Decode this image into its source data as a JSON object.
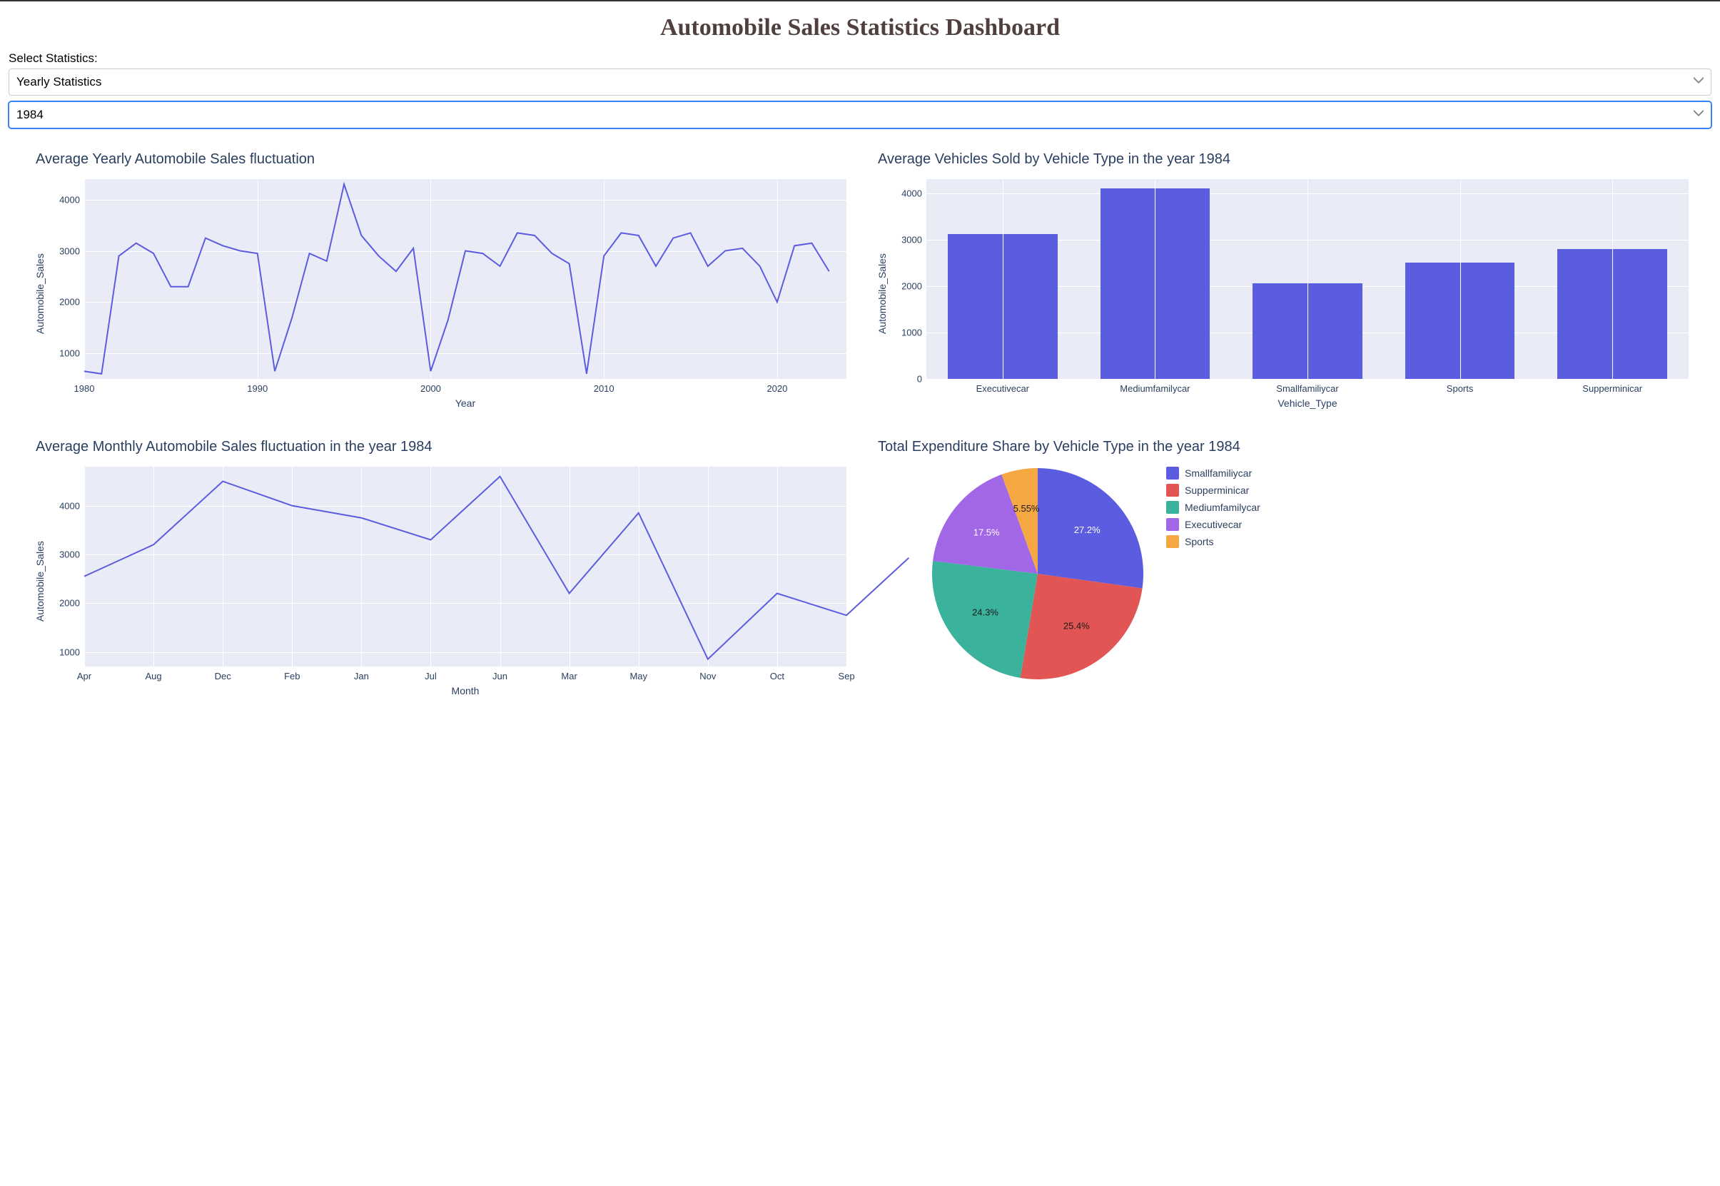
{
  "page": {
    "title": "Automobile Sales Statistics Dashboard",
    "select_label": "Select Statistics:",
    "statistic_value": "Yearly Statistics",
    "year_value": "1984"
  },
  "chart_data": [
    {
      "id": "yearly_line",
      "type": "line",
      "title": "Average Yearly Automobile Sales fluctuation",
      "xlabel": "Year",
      "ylabel": "Automobile_Sales",
      "xlim": [
        1980,
        2024
      ],
      "ylim": [
        500,
        4400
      ],
      "yticks": [
        1000,
        2000,
        3000,
        4000
      ],
      "xticks": [
        1980,
        1990,
        2000,
        2010,
        2020
      ],
      "x": [
        1980,
        1981,
        1982,
        1983,
        1984,
        1985,
        1986,
        1987,
        1988,
        1989,
        1990,
        1991,
        1992,
        1993,
        1994,
        1995,
        1996,
        1997,
        1998,
        1999,
        2000,
        2001,
        2002,
        2003,
        2004,
        2005,
        2006,
        2007,
        2008,
        2009,
        2010,
        2011,
        2012,
        2013,
        2014,
        2015,
        2016,
        2017,
        2018,
        2019,
        2020,
        2021,
        2022,
        2023
      ],
      "values": [
        650,
        600,
        2900,
        3150,
        2950,
        2300,
        2300,
        3250,
        3100,
        3000,
        2950,
        650,
        1700,
        2950,
        2800,
        4300,
        3300,
        2900,
        2600,
        3050,
        650,
        1650,
        3000,
        2950,
        2700,
        3350,
        3300,
        2950,
        2750,
        600,
        2900,
        3350,
        3300,
        2700,
        3250,
        3350,
        2700,
        3000,
        3050,
        2700,
        2000,
        3100,
        3150,
        2600
      ],
      "color": "#5c5ce0"
    },
    {
      "id": "vehicle_bar",
      "type": "bar",
      "title": "Average Vehicles Sold by Vehicle Type in the year 1984",
      "xlabel": "Vehicle_Type",
      "ylabel": "Automobile_Sales",
      "ylim": [
        0,
        4300
      ],
      "yticks": [
        0,
        1000,
        2000,
        3000,
        4000
      ],
      "categories": [
        "Executivecar",
        "Mediumfamilycar",
        "Smallfamiliycar",
        "Sports",
        "Supperminicar"
      ],
      "values": [
        3120,
        4100,
        2060,
        2510,
        2790
      ],
      "color": "#5c5ce0"
    },
    {
      "id": "monthly_line",
      "type": "line",
      "title": "Average Monthly Automobile Sales fluctuation in the year 1984",
      "xlabel": "Month",
      "ylabel": "Automobile_Sales",
      "ylim": [
        700,
        4800
      ],
      "yticks": [
        1000,
        2000,
        3000,
        4000
      ],
      "categories": [
        "Apr",
        "Aug",
        "Dec",
        "Feb",
        "Jan",
        "Jul",
        "Jun",
        "Mar",
        "May",
        "Nov",
        "Oct",
        "Sep"
      ],
      "values": [
        2550,
        3200,
        4500,
        4000,
        3750,
        3300,
        4600,
        2200,
        3850,
        850,
        2200,
        1750
      ],
      "extra_point": {
        "category": "Sep",
        "value": 2930
      },
      "color": "#5c5ce0"
    },
    {
      "id": "expenditure_pie",
      "type": "pie",
      "title": "Total Expenditure Share by Vehicle Type in the year 1984",
      "series": [
        {
          "name": "Smallfamiliycar",
          "value": 27.2,
          "label": "27.2%",
          "color": "#5c5ce0"
        },
        {
          "name": "Supperminicar",
          "value": 25.4,
          "label": "25.4%",
          "color": "#e15554"
        },
        {
          "name": "Mediumfamilycar",
          "value": 24.3,
          "label": "24.3%",
          "color": "#3bb29b"
        },
        {
          "name": "Executivecar",
          "value": 17.5,
          "label": "17.5%",
          "color": "#a267e6"
        },
        {
          "name": "Sports",
          "value": 5.55,
          "label": "5.55%",
          "color": "#f5a742"
        }
      ]
    }
  ]
}
